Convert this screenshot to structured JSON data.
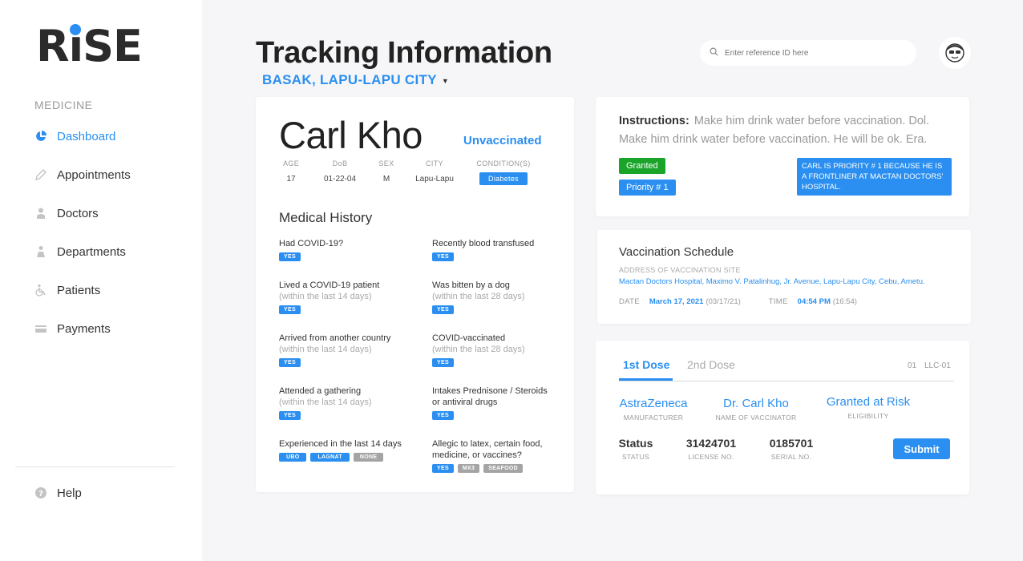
{
  "brand": {
    "logo": "RiSE",
    "accent": "#2a8ff0"
  },
  "sidebar": {
    "section": "MEDICINE",
    "items": [
      {
        "label": "Dashboard",
        "icon": "pie-chart-icon"
      },
      {
        "label": "Appointments",
        "icon": "pencil-icon"
      },
      {
        "label": "Doctors",
        "icon": "doctor-icon"
      },
      {
        "label": "Departments",
        "icon": "flask-icon"
      },
      {
        "label": "Patients",
        "icon": "wheelchair-icon"
      },
      {
        "label": "Payments",
        "icon": "card-icon"
      }
    ],
    "help": "Help"
  },
  "header": {
    "title": "Tracking Information",
    "location": "BASAK, LAPU-LAPU CITY",
    "search_placeholder": "Enter reference ID here"
  },
  "patient": {
    "name": "Carl Kho",
    "status": "Unvaccinated",
    "headers": [
      "AGE",
      "DoB",
      "SEX",
      "CITY",
      "CONDITION(S)"
    ],
    "age": "17",
    "dob": "01-22-04",
    "sex": "M",
    "city": "Lapu-Lapu",
    "condition": "Diabetes"
  },
  "history": {
    "title": "Medical History",
    "q1": {
      "t": "Had COVID-19?",
      "tags": [
        "YES"
      ]
    },
    "q2": {
      "t": "Recently blood transfused",
      "tags": [
        "YES"
      ]
    },
    "q3": {
      "t": "Lived a COVID-19 patient",
      "s": "(within the last 14 days)",
      "tags": [
        "YES"
      ]
    },
    "q4": {
      "t": "Was bitten by a dog",
      "s": "(within the last 28 days)",
      "tags": [
        "YES"
      ]
    },
    "q5": {
      "t": "Arrived from another country",
      "s": "(within the last 14 days)",
      "tags": [
        "YES"
      ]
    },
    "q6": {
      "t": "COVID-vaccinated",
      "s": "(within the last 28 days)",
      "tags": [
        "YES"
      ]
    },
    "q7": {
      "t": "Attended a gathering",
      "s": "(within the last 14 days)",
      "tags": [
        "YES"
      ]
    },
    "q8": {
      "t": "Intakes Prednisone / Steroids",
      "t2": "or antiviral drugs",
      "tags": [
        "YES"
      ]
    },
    "q9": {
      "t": "Experienced in the last 14 days",
      "tags": [
        "UBO",
        "LAGNAT",
        "NONE"
      ]
    },
    "q10": {
      "t": "Allegic to latex, certain food,",
      "t2": "medicine, or vaccines?",
      "tags": [
        "YES",
        "MX3",
        "SEAFOOD"
      ]
    }
  },
  "instructions": {
    "label": "Instructions:",
    "text": "Make him drink water before vaccination. Dol. Make him drink water before vaccination. He will be ok. Era.",
    "granted": "Granted",
    "priority": "Priority # 1",
    "note": "CARL IS PRIORITY # 1 BECAUSE HE IS A FRONTLINER AT MACTAN DOCTORS' HOSPITAL."
  },
  "schedule": {
    "title": "Vaccination Schedule",
    "address_label": "ADDRESS OF VACCINATION SITE",
    "address": "Mactan Doctors Hospital, Maximo V. Patalinhug, Jr. Avenue, Lapu-Lapu City, Cebu, Ametu.",
    "date_label": "DATE",
    "date": "March 17, 2021",
    "date_alt": "(03/17/21)",
    "time_label": "TIME",
    "time": "04:54 PM",
    "time_alt": "(16:54)"
  },
  "dose": {
    "tabs": [
      "1st Dose",
      "2nd Dose"
    ],
    "code1": "01",
    "code2": "LLC-01",
    "manufacturer": "AstraZeneca",
    "manufacturer_label": "MANUFACTURER",
    "vaccinator": "Dr. Carl Kho",
    "vaccinator_label": "NAME OF VACCINATOR",
    "eligibility": "Granted at Risk",
    "eligibility_label": "ELIGIBILITY",
    "status": "Status",
    "status_label": "STATUS",
    "license": "31424701",
    "license_label": "LICENSE NO.",
    "serial": "0185701",
    "serial_label": "SERIAL NO.",
    "submit": "Submit"
  }
}
